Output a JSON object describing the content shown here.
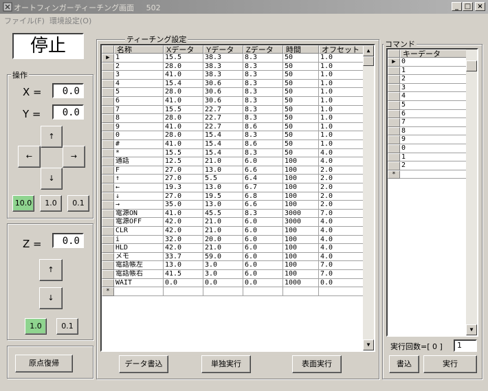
{
  "window": {
    "title": "オートフィンガーティーチング画面",
    "id": "502"
  },
  "menu": [
    {
      "label": "ファイル(F)"
    },
    {
      "label": "環境設定(O)"
    }
  ],
  "status": "停止",
  "operation": {
    "label": "操作",
    "x_label": "X =",
    "x_value": "0.0",
    "y_label": "Y =",
    "y_value": "0.0",
    "arrows": {
      "up": "↑",
      "down": "↓",
      "left": "←",
      "right": "→"
    },
    "steps": [
      "10.0",
      "1.0",
      "0.1"
    ]
  },
  "z": {
    "label": "Z =",
    "value": "0.0",
    "arrows": {
      "up": "↑",
      "down": "↓"
    },
    "steps": [
      "1.0",
      "0.1"
    ]
  },
  "home_button": "原点復帰",
  "teaching": {
    "label": "ティーチング設定",
    "columns": [
      "名称",
      "Xデータ",
      "Yデータ",
      "Zデータ",
      "時間",
      "オフセット"
    ],
    "rows": [
      [
        "1",
        "15.5",
        "38.3",
        "8.3",
        "50",
        "1.0"
      ],
      [
        "2",
        "28.0",
        "38.3",
        "8.3",
        "50",
        "1.0"
      ],
      [
        "3",
        "41.0",
        "38.3",
        "8.3",
        "50",
        "1.0"
      ],
      [
        "4",
        "15.4",
        "30.6",
        "8.3",
        "50",
        "1.0"
      ],
      [
        "5",
        "28.0",
        "30.6",
        "8.3",
        "50",
        "1.0"
      ],
      [
        "6",
        "41.0",
        "30.6",
        "8.3",
        "50",
        "1.0"
      ],
      [
        "7",
        "15.5",
        "22.7",
        "8.3",
        "50",
        "1.0"
      ],
      [
        "8",
        "28.0",
        "22.7",
        "8.3",
        "50",
        "1.0"
      ],
      [
        "9",
        "41.0",
        "22.7",
        "8.6",
        "50",
        "1.0"
      ],
      [
        "0",
        "28.0",
        "15.4",
        "8.3",
        "50",
        "1.0"
      ],
      [
        "#",
        "41.0",
        "15.4",
        "8.6",
        "50",
        "1.0"
      ],
      [
        "*",
        "15.5",
        "15.4",
        "8.3",
        "50",
        "4.0"
      ],
      [
        "通話",
        "12.5",
        "21.0",
        "6.0",
        "100",
        "4.0"
      ],
      [
        "F",
        "27.0",
        "13.0",
        "6.6",
        "100",
        "2.0"
      ],
      [
        "↑",
        "27.0",
        "5.5",
        "6.4",
        "100",
        "2.0"
      ],
      [
        "←",
        "19.3",
        "13.0",
        "6.7",
        "100",
        "2.0"
      ],
      [
        "↓",
        "27.0",
        "19.5",
        "6.8",
        "100",
        "2.0"
      ],
      [
        "→",
        "35.0",
        "13.0",
        "6.6",
        "100",
        "2.0"
      ],
      [
        "電源ON",
        "41.0",
        "45.5",
        "8.3",
        "3000",
        "7.0"
      ],
      [
        "電源OFF",
        "42.0",
        "21.0",
        "6.0",
        "3000",
        "4.0"
      ],
      [
        "CLR",
        "42.0",
        "21.0",
        "6.0",
        "100",
        "4.0"
      ],
      [
        "i",
        "32.0",
        "20.0",
        "6.0",
        "100",
        "4.0"
      ],
      [
        "HLD",
        "42.0",
        "21.0",
        "6.0",
        "100",
        "4.0"
      ],
      [
        "メモ",
        "33.7",
        "59.0",
        "6.0",
        "100",
        "4.0"
      ],
      [
        "電話帳左",
        "13.0",
        "3.0",
        "6.0",
        "100",
        "7.0"
      ],
      [
        "電話帳右",
        "41.5",
        "3.0",
        "6.0",
        "100",
        "7.0"
      ],
      [
        "WAIT",
        "0.0",
        "0.0",
        "0.0",
        "1000",
        "0.0"
      ]
    ],
    "new_row_marker": "*",
    "current_marker": "▶"
  },
  "buttons": {
    "write_data": "データ書込",
    "single_run": "単独実行",
    "surface_run": "表面実行"
  },
  "command": {
    "label": "コマンド",
    "column": "キーデータ",
    "rows": [
      "0",
      "1",
      "2",
      "3",
      "4",
      "5",
      "6",
      "7",
      "8",
      "9",
      "0",
      "1",
      "2"
    ],
    "new_row_marker": "*",
    "exec_count_label": "実行回数=[ 0 ]",
    "exec_count_value": "1",
    "write_button": "書込",
    "run_button": "実行"
  },
  "scroll": {
    "up": "▲",
    "down": "▼"
  }
}
